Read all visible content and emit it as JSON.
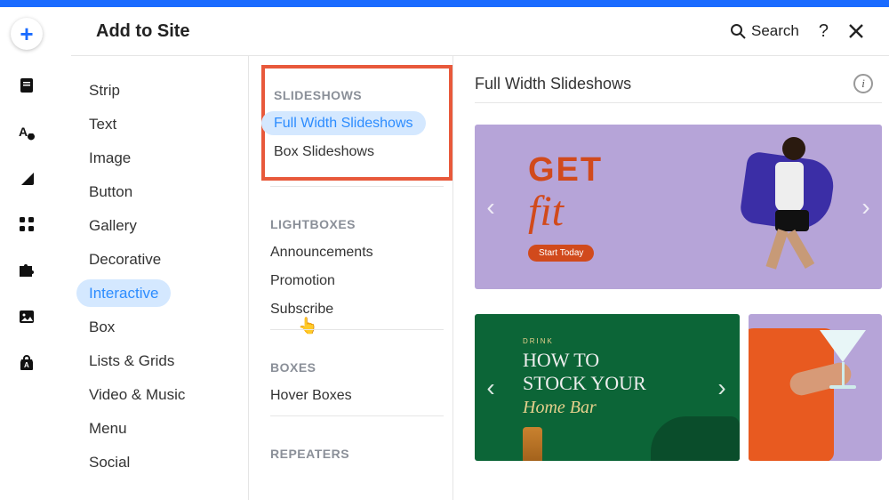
{
  "header": {
    "title": "Add to Site",
    "search": "Search"
  },
  "sidebar_icons": [
    "add",
    "page",
    "text-theme",
    "section",
    "grid",
    "puzzle",
    "image",
    "app-store"
  ],
  "categories": [
    "Strip",
    "Text",
    "Image",
    "Button",
    "Gallery",
    "Decorative",
    "Interactive",
    "Box",
    "Lists & Grids",
    "Video & Music",
    "Menu",
    "Social"
  ],
  "categories_active": 6,
  "col2": {
    "highlight": {
      "title": "SLIDESHOWS",
      "items": [
        "Full Width Slideshows",
        "Box Slideshows"
      ],
      "active": 0
    },
    "groups": [
      {
        "title": "LIGHTBOXES",
        "items": [
          "Announcements",
          "Promotion",
          "Subscribe"
        ]
      },
      {
        "title": "BOXES",
        "items": [
          "Hover Boxes"
        ]
      },
      {
        "title": "REPEATERS",
        "items": []
      }
    ]
  },
  "preview": {
    "heading": "Full Width Slideshows",
    "slide1": {
      "t1": "GET",
      "t2": "fit",
      "cta": "Start Today"
    },
    "slide2": {
      "line1": "HOW TO",
      "line2": "STOCK YOUR",
      "line3": "Home Bar",
      "tag": "DRINK"
    }
  }
}
